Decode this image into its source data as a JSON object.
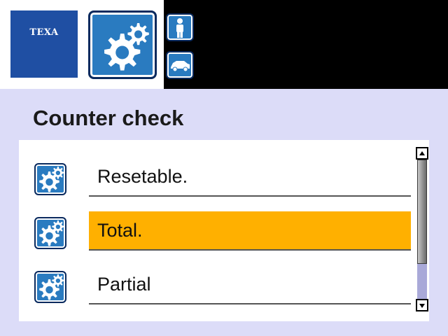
{
  "header": {
    "logo_text": "TEXA",
    "main_icon": "gears-icon",
    "mode_icons": [
      "person-icon",
      "car-icon"
    ]
  },
  "page": {
    "title": "Counter check"
  },
  "list": {
    "items": [
      {
        "label": "Resetable.",
        "icon": "gears-icon",
        "selected": false
      },
      {
        "label": "Total.",
        "icon": "gears-icon",
        "selected": true
      },
      {
        "label": "Partial",
        "icon": "gears-icon",
        "selected": false
      }
    ]
  },
  "scrollbar": {
    "visible_fraction": 0.75,
    "position": 0
  },
  "colors": {
    "brand_blue": "#1f4fa3",
    "icon_blue": "#2a7bc0",
    "selection": "#ffb000",
    "panel_lavender": "#dcdcf8"
  }
}
